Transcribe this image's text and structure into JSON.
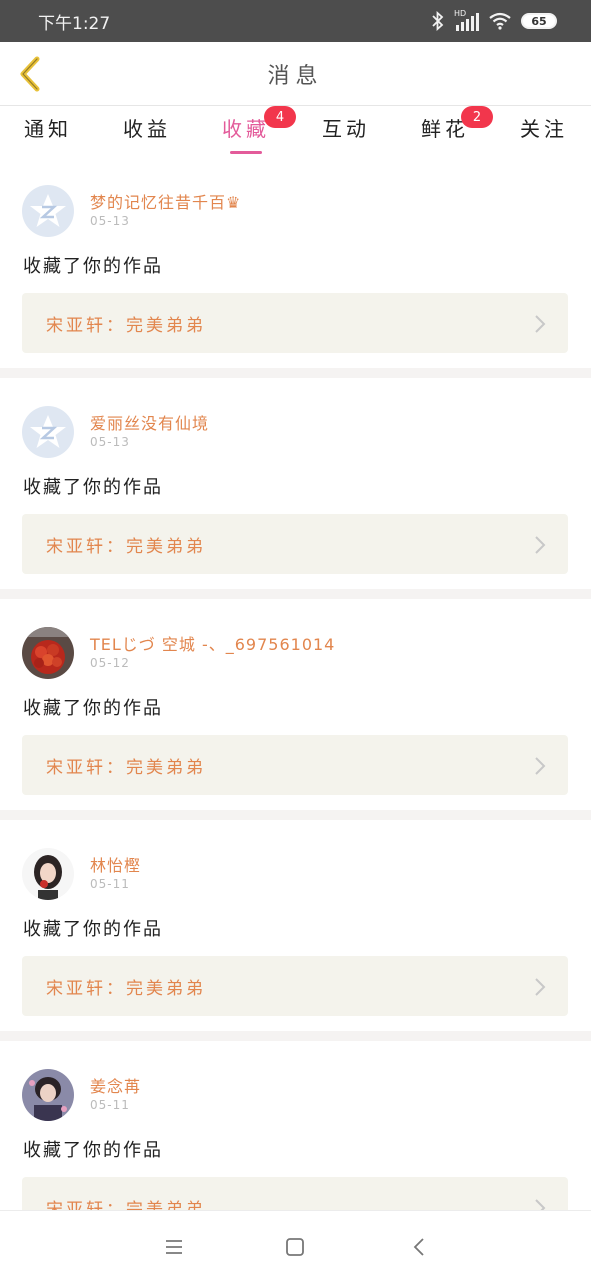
{
  "status_bar": {
    "time": "下午1:27",
    "battery": "65",
    "network": "HD"
  },
  "header": {
    "title": "消息",
    "back_icon": "chevron-left-icon"
  },
  "tabs": [
    {
      "label": "通知",
      "badge": ""
    },
    {
      "label": "收益",
      "badge": ""
    },
    {
      "label": "收藏",
      "badge": "4",
      "active": true
    },
    {
      "label": "互动",
      "badge": ""
    },
    {
      "label": "鲜花",
      "badge": "2"
    },
    {
      "label": "关注",
      "badge": ""
    }
  ],
  "colors": {
    "accent": "#e35b9a",
    "username": "#e2864e",
    "badge": "#f2364c",
    "card_box": "#f4f3ec"
  },
  "messages": [
    {
      "username": "梦的记忆往昔千百♛",
      "date": "05-13",
      "action": "收藏了你的作品",
      "work": "宋亚轩：完美弟弟",
      "avatar": "default-avatar-icon"
    },
    {
      "username": "爱丽丝没有仙境",
      "date": "05-13",
      "action": "收藏了你的作品",
      "work": "宋亚轩：完美弟弟",
      "avatar": "default-avatar-icon"
    },
    {
      "username": "TELじづ 空城 -、_697561014",
      "date": "05-12",
      "action": "收藏了你的作品",
      "work": "宋亚轩：完美弟弟",
      "avatar": "roses-photo"
    },
    {
      "username": "林怡樫",
      "date": "05-11",
      "action": "收藏了你的作品",
      "work": "宋亚轩：完美弟弟",
      "avatar": "girl-photo"
    },
    {
      "username": "姜念苒",
      "date": "05-11",
      "action": "收藏了你的作品",
      "work": "宋亚轩：完美弟弟",
      "avatar": "boy-photo"
    }
  ],
  "nav": {
    "menu_icon": "menu-icon",
    "home_icon": "home-square-icon",
    "back_icon": "back-triangle-icon"
  }
}
